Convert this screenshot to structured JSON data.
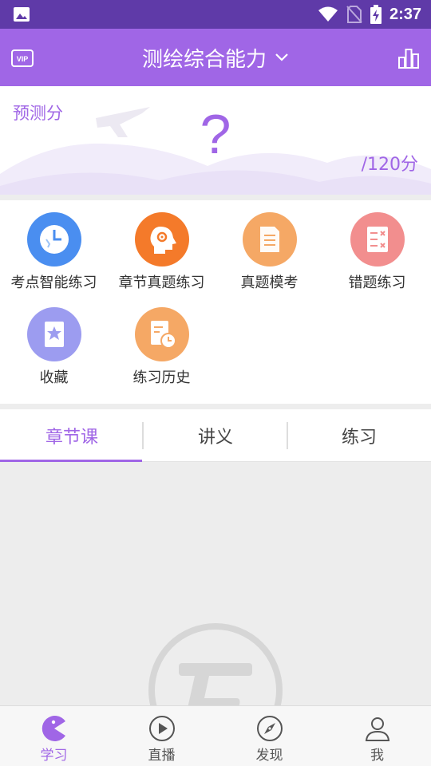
{
  "status_bar": {
    "time": "2:37"
  },
  "header": {
    "title": "测绘综合能力",
    "vip_icon": "vip-icon",
    "stats_icon": "bar-chart-icon"
  },
  "score": {
    "label": "预测分",
    "value": "?",
    "total": "/120分"
  },
  "features": [
    {
      "label": "考点智能练习",
      "icon": "clock-icon",
      "color": "#4a8ef0"
    },
    {
      "label": "章节真题练习",
      "icon": "head-gear-icon",
      "color": "#f47a2a"
    },
    {
      "label": "真题模考",
      "icon": "document-icon",
      "color": "#f5a865"
    },
    {
      "label": "错题练习",
      "icon": "wrong-list-icon",
      "color": "#f28e8e"
    },
    {
      "label": "收藏",
      "icon": "star-book-icon",
      "color": "#9c9cf0"
    },
    {
      "label": "练习历史",
      "icon": "history-icon",
      "color": "#f5a865"
    }
  ],
  "tabs": [
    {
      "label": "章节课",
      "active": true
    },
    {
      "label": "讲义",
      "active": false
    },
    {
      "label": "练习",
      "active": false
    }
  ],
  "bottom_nav": [
    {
      "label": "学习",
      "icon": "pacman-icon",
      "active": true
    },
    {
      "label": "直播",
      "icon": "play-circle-icon",
      "active": false
    },
    {
      "label": "发现",
      "icon": "compass-icon",
      "active": false
    },
    {
      "label": "我",
      "icon": "person-icon",
      "active": false
    }
  ],
  "colors": {
    "status_bar": "#5f3aa8",
    "header": "#a066e6",
    "accent": "#a066e6"
  }
}
